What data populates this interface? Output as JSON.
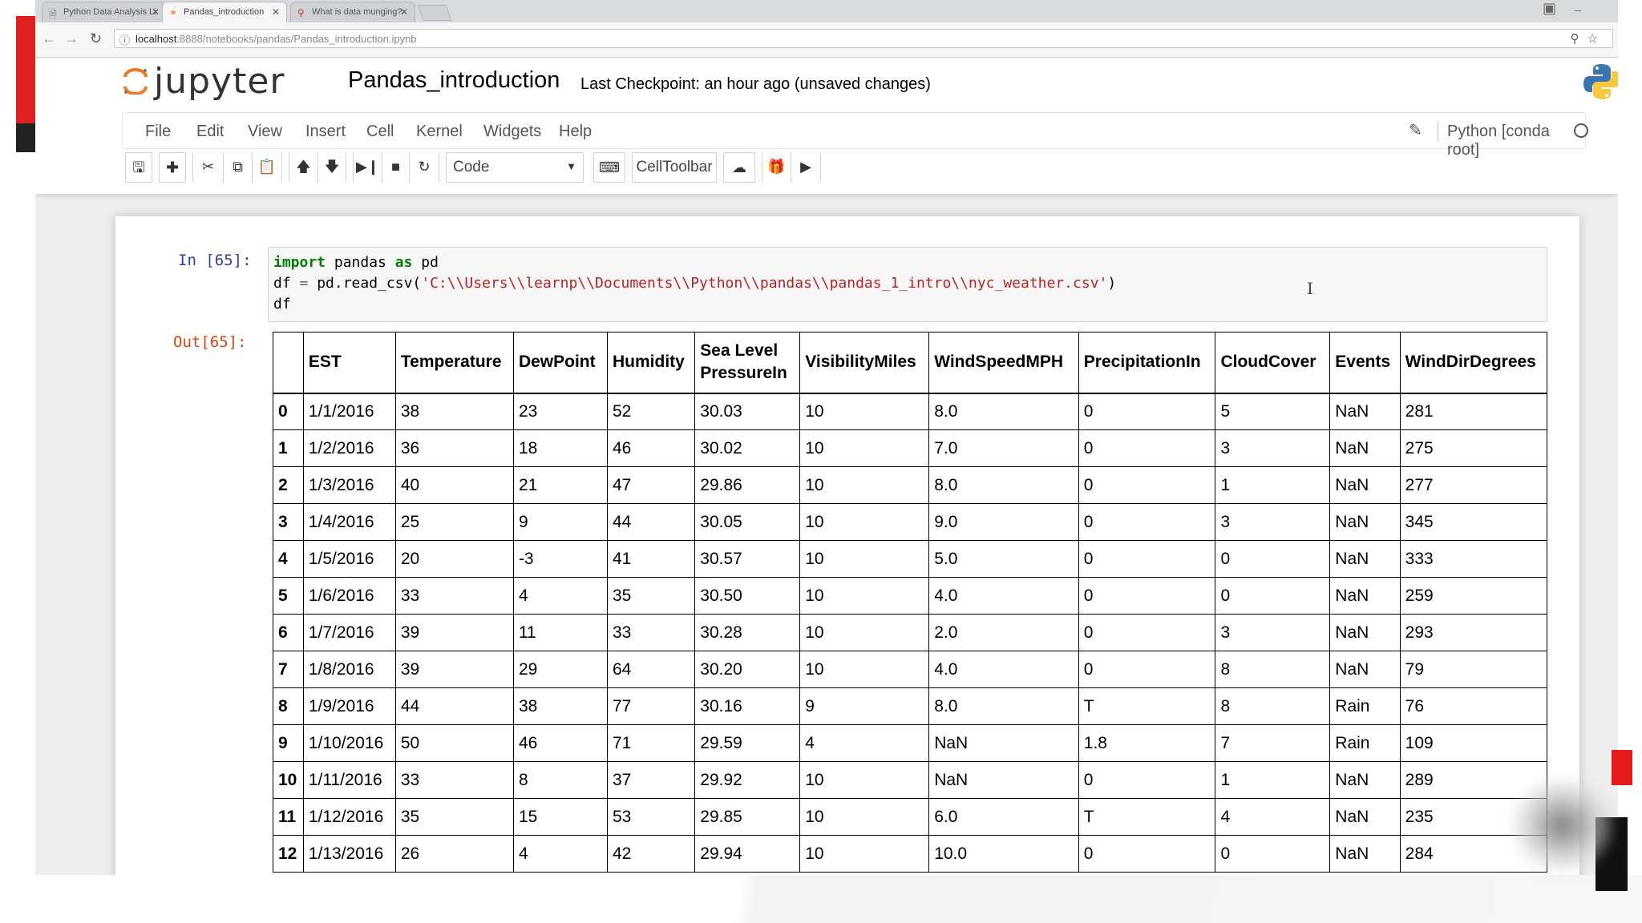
{
  "browser": {
    "tabs": [
      {
        "label": "Python Data Analysis Li",
        "icon": "doc-icon",
        "active": false
      },
      {
        "label": "Pandas_introduction",
        "icon": "jupyter-icon",
        "active": true
      },
      {
        "label": "What is data munging?",
        "icon": "search-icon",
        "active": false
      }
    ],
    "url_host": "localhost",
    "url_path": ":8888/notebooks/pandas/Pandas_introduction.ipynb"
  },
  "jupyter": {
    "logo_text": "jupyter",
    "notebook_name": "Pandas_introduction",
    "checkpoint": "Last Checkpoint: an hour ago (unsaved changes)",
    "menu": [
      "File",
      "Edit",
      "View",
      "Insert",
      "Cell",
      "Kernel",
      "Widgets",
      "Help"
    ],
    "kernel_name": "Python [conda root]",
    "toolbar": {
      "cell_type": "Code",
      "celltoolbar_label": "CellToolbar"
    }
  },
  "cell": {
    "in_prompt": "In [65]:",
    "out_prompt": "Out[65]:",
    "code": {
      "line1_kw1": "import",
      "line1_mid": " pandas ",
      "line1_kw2": "as",
      "line1_end": " pd",
      "line2_start": "df ",
      "line2_op": "=",
      "line2_mid": " pd.read_csv(",
      "line2_str": "'C:\\\\Users\\\\learnp\\\\Documents\\\\Python\\\\pandas\\\\pandas_1_intro\\\\nyc_weather.csv'",
      "line2_end": ")",
      "line3": "df"
    }
  },
  "dataframe": {
    "columns": [
      "",
      "EST",
      "Temperature",
      "DewPoint",
      "Humidity",
      "Sea Level PressureIn",
      "VisibilityMiles",
      "WindSpeedMPH",
      "PrecipitationIn",
      "CloudCover",
      "Events",
      "WindDirDegrees"
    ],
    "rows": [
      [
        "0",
        "1/1/2016",
        "38",
        "23",
        "52",
        "30.03",
        "10",
        "8.0",
        "0",
        "5",
        "NaN",
        "281"
      ],
      [
        "1",
        "1/2/2016",
        "36",
        "18",
        "46",
        "30.02",
        "10",
        "7.0",
        "0",
        "3",
        "NaN",
        "275"
      ],
      [
        "2",
        "1/3/2016",
        "40",
        "21",
        "47",
        "29.86",
        "10",
        "8.0",
        "0",
        "1",
        "NaN",
        "277"
      ],
      [
        "3",
        "1/4/2016",
        "25",
        "9",
        "44",
        "30.05",
        "10",
        "9.0",
        "0",
        "3",
        "NaN",
        "345"
      ],
      [
        "4",
        "1/5/2016",
        "20",
        "-3",
        "41",
        "30.57",
        "10",
        "5.0",
        "0",
        "0",
        "NaN",
        "333"
      ],
      [
        "5",
        "1/6/2016",
        "33",
        "4",
        "35",
        "30.50",
        "10",
        "4.0",
        "0",
        "0",
        "NaN",
        "259"
      ],
      [
        "6",
        "1/7/2016",
        "39",
        "11",
        "33",
        "30.28",
        "10",
        "2.0",
        "0",
        "3",
        "NaN",
        "293"
      ],
      [
        "7",
        "1/8/2016",
        "39",
        "29",
        "64",
        "30.20",
        "10",
        "4.0",
        "0",
        "8",
        "NaN",
        "79"
      ],
      [
        "8",
        "1/9/2016",
        "44",
        "38",
        "77",
        "30.16",
        "9",
        "8.0",
        "T",
        "8",
        "Rain",
        "76"
      ],
      [
        "9",
        "1/10/2016",
        "50",
        "46",
        "71",
        "29.59",
        "4",
        "NaN",
        "1.8",
        "7",
        "Rain",
        "109"
      ],
      [
        "10",
        "1/11/2016",
        "33",
        "8",
        "37",
        "29.92",
        "10",
        "NaN",
        "0",
        "1",
        "NaN",
        "289"
      ],
      [
        "11",
        "1/12/2016",
        "35",
        "15",
        "53",
        "29.85",
        "10",
        "6.0",
        "T",
        "4",
        "NaN",
        "235"
      ],
      [
        "12",
        "1/13/2016",
        "26",
        "4",
        "42",
        "29.94",
        "10",
        "10.0",
        "0",
        "0",
        "NaN",
        "284"
      ]
    ]
  }
}
